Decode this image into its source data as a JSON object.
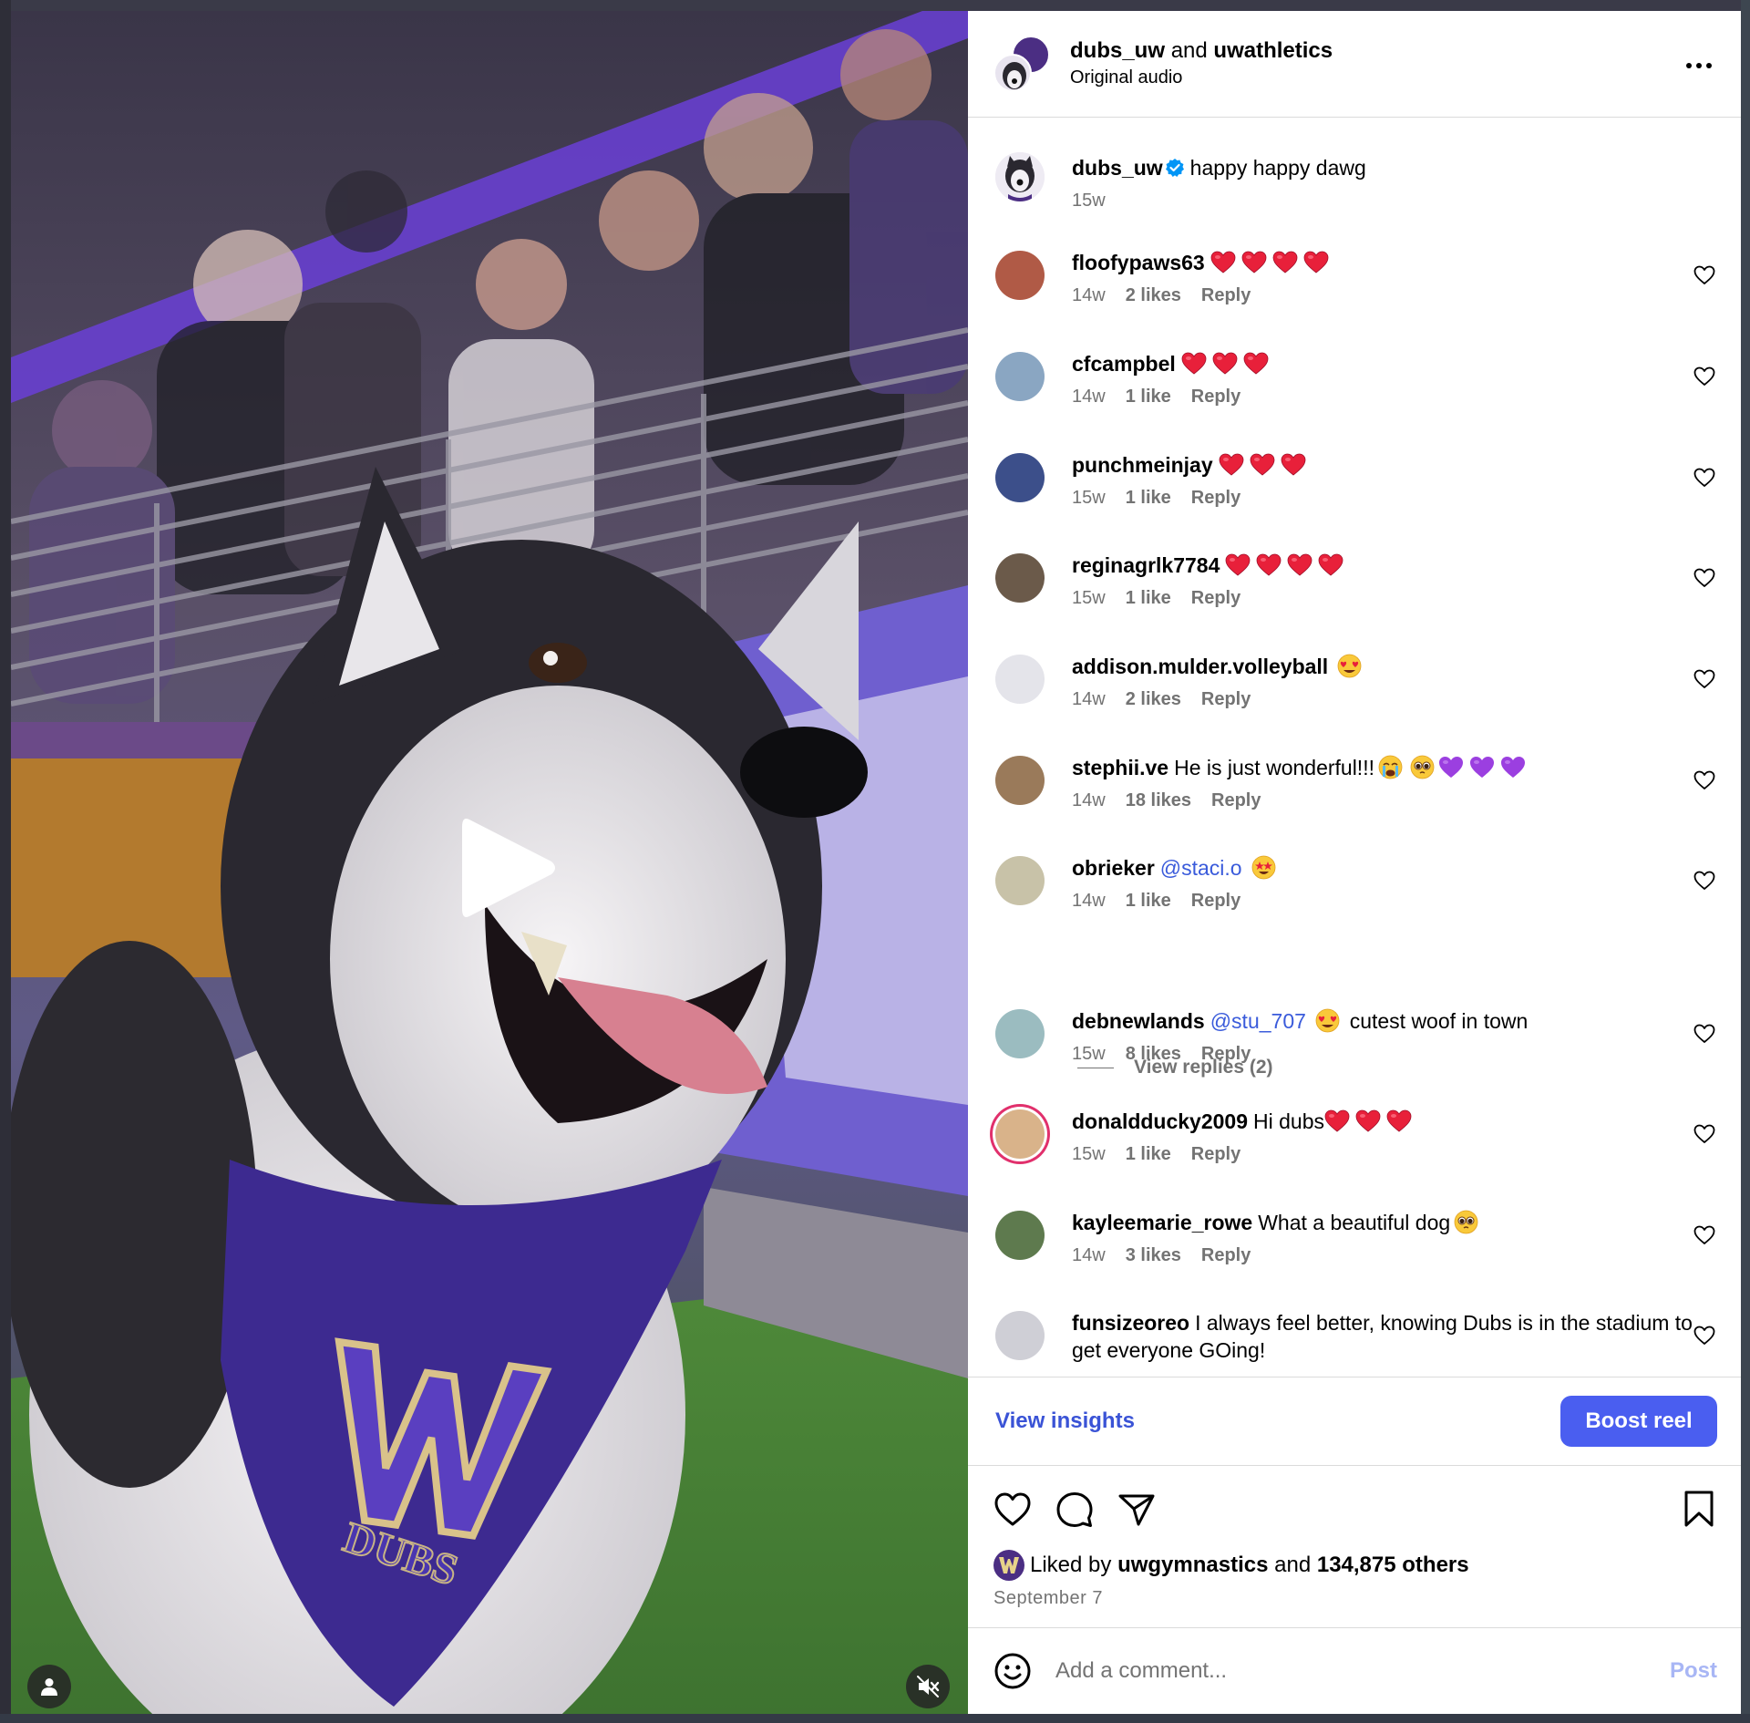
{
  "post": {
    "authors": {
      "primary": "dubs_uw",
      "joiner": "and",
      "secondary": "uwathletics"
    },
    "audio": "Original audio",
    "caption": {
      "user": "dubs_uw",
      "text": "happy happy dawg",
      "time": "15w"
    }
  },
  "comments": [
    {
      "user": "floofypaws63",
      "text": "",
      "emoji_hearts": 4,
      "emoji_faces": [],
      "time": "14w",
      "likes": "2 likes",
      "reply": "Reply",
      "avatar_color": "#b05a46"
    },
    {
      "user": "cfcampbel",
      "text": "",
      "emoji_hearts": 3,
      "emoji_faces": [],
      "time": "14w",
      "likes": "1 like",
      "reply": "Reply",
      "avatar_color": "#8aa6c2"
    },
    {
      "user": "punchmeinjay",
      "text": "",
      "emoji_hearts": 3,
      "emoji_faces": [],
      "time": "15w",
      "likes": "1 like",
      "reply": "Reply",
      "avatar_color": "#3c4f8a"
    },
    {
      "user": "reginagrlk7784",
      "text": "",
      "emoji_hearts": 4,
      "emoji_faces": [],
      "time": "15w",
      "likes": "1 like",
      "reply": "Reply",
      "avatar_color": "#6b5a4a"
    },
    {
      "user": "addison.mulder.volleyball",
      "text": "",
      "emoji_hearts": 0,
      "emoji_faces": [
        "heart-eyes"
      ],
      "time": "14w",
      "likes": "2 likes",
      "reply": "Reply",
      "avatar_color": "#e4e4ea"
    },
    {
      "user": "stephii.ve",
      "text": "He is just wonderful!!!",
      "emoji_hearts": 0,
      "emoji_faces": [
        "crying",
        "pleading"
      ],
      "purple_hearts": 3,
      "time": "14w",
      "likes": "18 likes",
      "reply": "Reply",
      "avatar_color": "#9a7a5a"
    },
    {
      "user": "obrieker",
      "text": "",
      "mention": "@staci.o",
      "emoji_hearts": 0,
      "emoji_faces": [
        "star-struck"
      ],
      "time": "14w",
      "likes": "1 like",
      "reply": "Reply",
      "avatar_color": "#c8c2a8"
    },
    {
      "user": "debnewlands",
      "text": "cutest woof in town",
      "mention": "@stu_707",
      "emoji_hearts": 0,
      "emoji_faces": [
        "heart-eyes"
      ],
      "time": "15w",
      "likes": "8 likes",
      "reply": "Reply",
      "avatar_color": "#9bbcc0"
    },
    {
      "user": "donaldducky2009",
      "text": "Hi dubs",
      "emoji_hearts": 3,
      "emoji_faces": [],
      "time": "15w",
      "likes": "1 like",
      "reply": "Reply",
      "avatar_color": "#d9b38a"
    },
    {
      "user": "kayleemarie_rowe",
      "text": "What a beautiful dog",
      "emoji_hearts": 0,
      "emoji_faces": [
        "pleading"
      ],
      "time": "14w",
      "likes": "3 likes",
      "reply": "Reply",
      "avatar_color": "#5e7a4e"
    },
    {
      "user": "funsizeoreo",
      "text": "I always feel better, knowing Dubs is in the stadium to get everyone GOing!",
      "emoji_hearts": 0,
      "emoji_faces": [],
      "time": "",
      "likes": "",
      "reply": "",
      "avatar_color": "#cfcfd6"
    }
  ],
  "view_replies": "View replies (2)",
  "insights": {
    "view_label": "View insights",
    "boost_label": "Boost reel"
  },
  "likes": {
    "prefix": "Liked by",
    "user": "uwgymnastics",
    "joiner": "and",
    "count": "134,875 others"
  },
  "date": "September 7",
  "comment_box": {
    "placeholder": "Add a comment...",
    "post_label": "Post"
  },
  "colors": {
    "accent": "#4a5ef0",
    "link": "#3a53d6",
    "mention": "#3a5bdb",
    "heart": "#e8203a",
    "purple_heart": "#9b3fe0",
    "uw_purple": "#4b2e83"
  },
  "icons": [
    "more-icon",
    "verified-icon",
    "heart-icon",
    "comment-icon",
    "share-icon",
    "bookmark-icon",
    "emoji-icon",
    "play-icon",
    "tag-user-icon",
    "mute-icon"
  ]
}
